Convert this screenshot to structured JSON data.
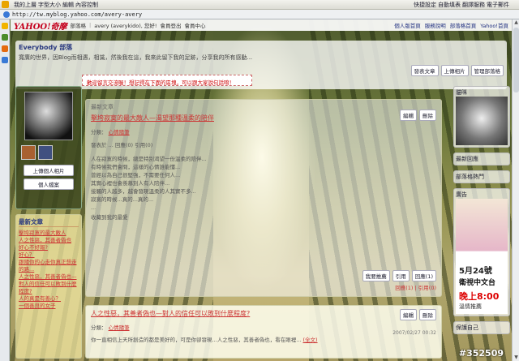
{
  "browser": {
    "toolbar_items": [
      "我的上層",
      "字型大小",
      "編輯",
      "內容控制"
    ],
    "right_items": [
      "快捷設定",
      "自動填表",
      "翻譯服務",
      "電子郵件"
    ],
    "url": "http://tw.myblog.yahoo.com/avery-avery"
  },
  "yahoo": {
    "logo": "YAHOO!奇摩",
    "links": [
      "部落格",
      "avery (averykido), 您好!",
      "會員登出",
      "會員中心"
    ],
    "right_links": [
      "個人版首頁",
      "服務說明",
      "部落格首頁",
      "Yahoo!首頁"
    ]
  },
  "blog": {
    "title": "Everybody 部落",
    "desc": "寬廣的世界，因Blog而相遇，相識，然後我在這，我來此留下我的足跡，分享我的所有感動..."
  },
  "head_buttons": [
    "發表文章",
    "上傳相片",
    "管理部落格"
  ],
  "notice": "歡迎留言交流喔！想記得在下面的區塊，可以跟大家說句話唷！",
  "profile": {
    "buttons": [
      "上傳個人相片",
      "個人檔案"
    ]
  },
  "news": {
    "title": "最新文章",
    "items": [
      "擊垮寂寞的最大敵人",
      "人之性惡，其善者偽也",
      "好心不好報?",
      "好心？",
      "跟隨你的心走你真正想走的路...",
      "人之性惡，其善者偽也—對人的信任可以敗到什麼程度?",
      "人的真是有善心？",
      "一個善良的女子"
    ]
  },
  "post1": {
    "section": "最新文章",
    "title": "擊垮寂寞的最大敵人—渴望那種溫柔的陪伴",
    "category_label": "分類：",
    "category": "心情隨筆",
    "edit_label": "編輯",
    "delete_label": "刪除",
    "meta": "發表於 ... 回應(0) 引用(0)",
    "body": "人在寂寞的時候，總是特別渴望一份溫柔的陪伴...\n有時候我們會問，這樣的心情誰能懂...\n曾經以為自己很堅強，不需要任何人...\n其實心裡也會羨慕別人有人陪伴...\n接觸的人越多，越會發現溫柔的人其實不多...\n寂寞的時候...真的...真的...\n...",
    "more": "收藏到我的最愛",
    "tools": [
      "我要推薦",
      "引用",
      "回應(1)"
    ],
    "footer": "回應(1) | 引用(0)"
  },
  "post2": {
    "title": "人之性惡，其善者偽也—對人的信任可以敗到什麼程度?",
    "category_label": "分類：",
    "category": "心情隨筆",
    "edit_label": "編輯",
    "delete_label": "刪除",
    "date": "2007/02/27 00:32",
    "body": "你一直相信上天所創造的都是美好的，可是你卻發現...人之性惡，其善者偽也，看在眼裡...",
    "more": "(全文)"
  },
  "right": {
    "cat_box": "貓咪",
    "news_box": "最新回應",
    "hot_box": "部落格熱門",
    "ad_head": "廣告",
    "ad_date": "5月24號",
    "ad_channel": "衛視中文台",
    "ad_time": "晚上8:00",
    "ad_tag": "溫情推薦",
    "footer": "保護自己"
  },
  "watermark": "#352509"
}
